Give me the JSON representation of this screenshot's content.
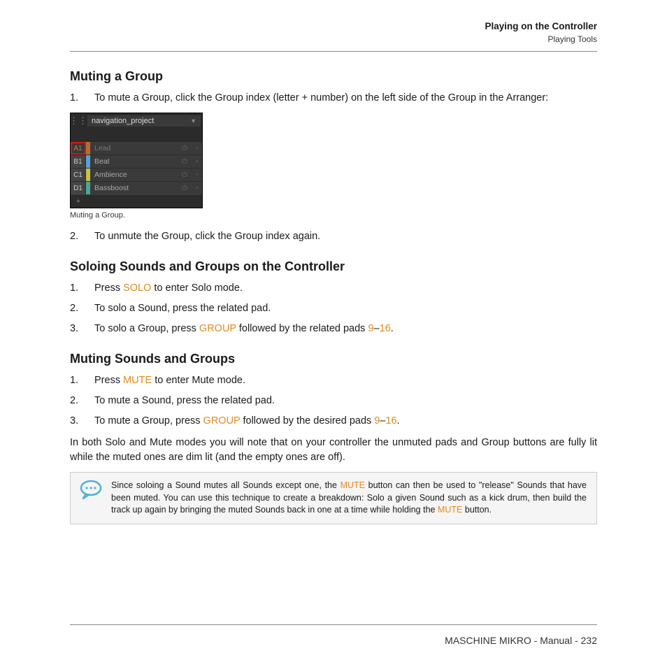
{
  "header": {
    "section": "Playing on the Controller",
    "subsection": "Playing Tools"
  },
  "h_mute_group": "Muting a Group",
  "mute_group_steps": {
    "s1": "To mute a Group, click the Group index (letter + number) on the left side of the Group in the Arranger:",
    "s2": "To unmute the Group, click the Group index again."
  },
  "ui": {
    "project_name": "navigation_project",
    "rows": [
      {
        "idx": "A1",
        "name": "Lead",
        "color": "#b56d2e"
      },
      {
        "idx": "B1",
        "name": "Beat",
        "color": "#5aa0d8"
      },
      {
        "idx": "C1",
        "name": "Ambience",
        "color": "#c9c14a"
      },
      {
        "idx": "D1",
        "name": "Bassboost",
        "color": "#4aa89a"
      }
    ]
  },
  "caption_mute": "Muting a Group.",
  "h_solo": "Soloing Sounds and Groups on the Controller",
  "solo_steps": {
    "s1a": "Press ",
    "s1b": "SOLO",
    "s1c": " to enter Solo mode.",
    "s2": "To solo a Sound, press the related pad.",
    "s3a": "To solo a Group, press ",
    "s3b": "GROUP",
    "s3c": " followed by the related pads ",
    "s3d": "9",
    "s3e": "–",
    "s3f": "16",
    "s3g": "."
  },
  "h_muting": "Muting Sounds and Groups",
  "mute_steps": {
    "s1a": "Press ",
    "s1b": "MUTE",
    "s1c": " to enter Mute mode.",
    "s2": "To mute a Sound, press the related pad.",
    "s3a": "To mute a Group, press ",
    "s3b": "GROUP",
    "s3c": " followed by the desired pads ",
    "s3d": "9",
    "s3e": "–",
    "s3f": "16",
    "s3g": "."
  },
  "note_para": "In both Solo and Mute modes you will note that on your controller the unmuted pads and Group buttons are fully lit while the muted ones are dim lit (and the empty ones are off).",
  "tip": {
    "t1": "Since soloing a Sound mutes all Sounds except one, the ",
    "t2": "MUTE",
    "t3": " button can then be used to \"release\" Sounds that have been muted. You can use this technique to create a breakdown: Solo a given Sound such as a kick drum, then build the track up again by bringing the muted Sounds back in one at a time while holding the ",
    "t4": "MUTE",
    "t5": " button."
  },
  "footer": "MASCHINE MIKRO - Manual - 232"
}
